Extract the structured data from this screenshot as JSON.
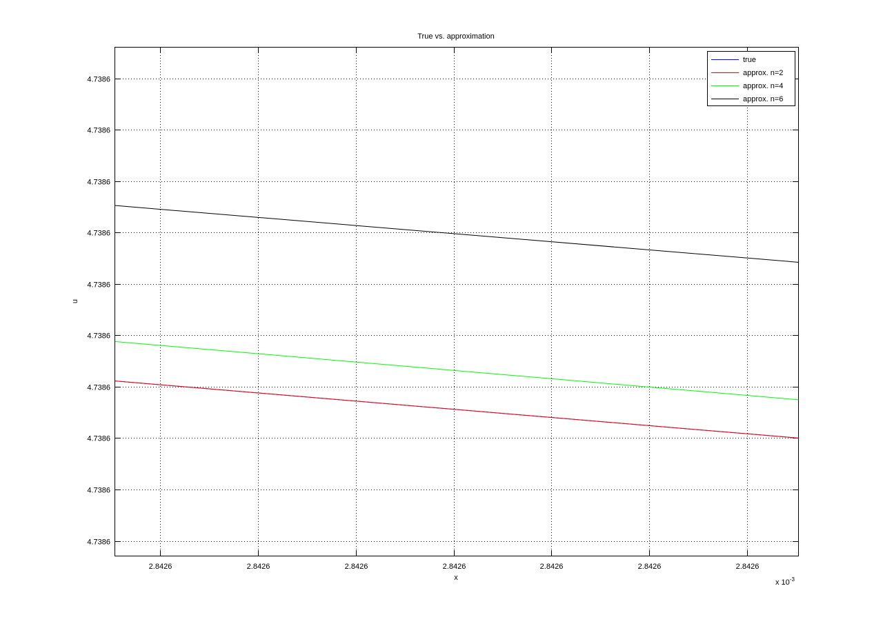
{
  "chart_data": {
    "type": "line",
    "title": "True vs. approximation",
    "xlabel": "x",
    "ylabel": "u",
    "x_exponent_base": "x 10",
    "x_exponent_power": "-3",
    "x_tick_labels": [
      "2.8426",
      "2.8426",
      "2.8426",
      "2.8426",
      "2.8426",
      "2.8426",
      "2.8426"
    ],
    "y_tick_labels": [
      "4.7386",
      "4.7386",
      "4.7386",
      "4.7386",
      "4.7386",
      "4.7386",
      "4.7386",
      "4.7386",
      "4.7386",
      "4.7386"
    ],
    "xlim": [
      0,
      1
    ],
    "ylim": [
      0,
      1
    ],
    "x_ticks": [
      0.0666,
      0.2096,
      0.3526,
      0.4955,
      0.6385,
      0.7815,
      0.9245
    ],
    "y_ticks": [
      0.0303,
      0.1312,
      0.2321,
      0.333,
      0.4339,
      0.5348,
      0.6357,
      0.7366,
      0.8375,
      0.9384
    ],
    "grid": true,
    "legend_position": "top-right",
    "series": [
      {
        "name": "true",
        "color": "#0000ff",
        "x": [
          0,
          1
        ],
        "y": [
          0.3443,
          0.2321
        ]
      },
      {
        "name": "approx. n=2",
        "color": "#ff0000",
        "x": [
          0,
          1
        ],
        "y": [
          0.3443,
          0.2321
        ]
      },
      {
        "name": "approx. n=4",
        "color": "#00ff00",
        "x": [
          0,
          1
        ],
        "y": [
          0.4217,
          0.3073
        ]
      },
      {
        "name": "approx. n=6",
        "color": "#000000",
        "x": [
          0,
          1
        ],
        "y": [
          0.6887,
          0.5772
        ]
      }
    ]
  }
}
